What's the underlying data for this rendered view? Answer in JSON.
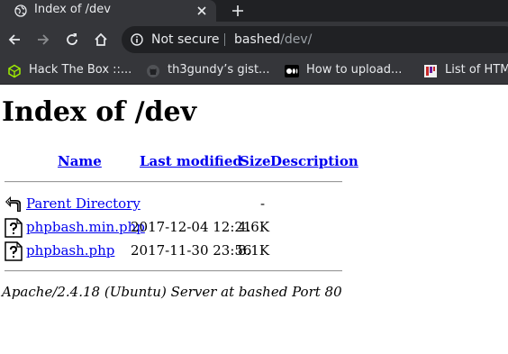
{
  "browser": {
    "tab": {
      "title": "Index of /dev"
    },
    "omnibox": {
      "security_label": "Not secure",
      "url_host": "bashed",
      "url_path": "/dev/"
    },
    "bookmarks": [
      {
        "label": "Hack The Box ::...",
        "icon": "hackthebox-cube-icon"
      },
      {
        "label": "th3gundy’s gist...",
        "icon": "github-octocat-icon"
      },
      {
        "label": "How to upload...",
        "icon": "medium-logo-icon"
      },
      {
        "label": "List of HTML",
        "icon": "document-bars-icon"
      }
    ],
    "colors": {
      "tabstrip": "#202124",
      "toolbar": "#35363a",
      "omnibox": "#202124",
      "text": "#e8eaed",
      "hackthebox_green": "#9fef00"
    }
  },
  "page": {
    "heading": "Index of /dev",
    "columns": {
      "name": "Name",
      "last_modified": "Last modified",
      "size": "Size",
      "description": "Description"
    },
    "rows": [
      {
        "name": "Parent Directory",
        "modified": "",
        "size": "-",
        "icon": "back-arrow-icon"
      },
      {
        "name": "phpbash.min.php",
        "modified": "2017-12-04 12:21",
        "size": "4.6K",
        "icon": "unknown-file-icon"
      },
      {
        "name": "phpbash.php",
        "modified": "2017-11-30 23:56",
        "size": "8.1K",
        "icon": "unknown-file-icon"
      }
    ],
    "address": "Apache/2.4.18 (Ubuntu) Server at bashed Port 80",
    "colors": {
      "link": "#0000ee",
      "text": "#000000"
    }
  }
}
